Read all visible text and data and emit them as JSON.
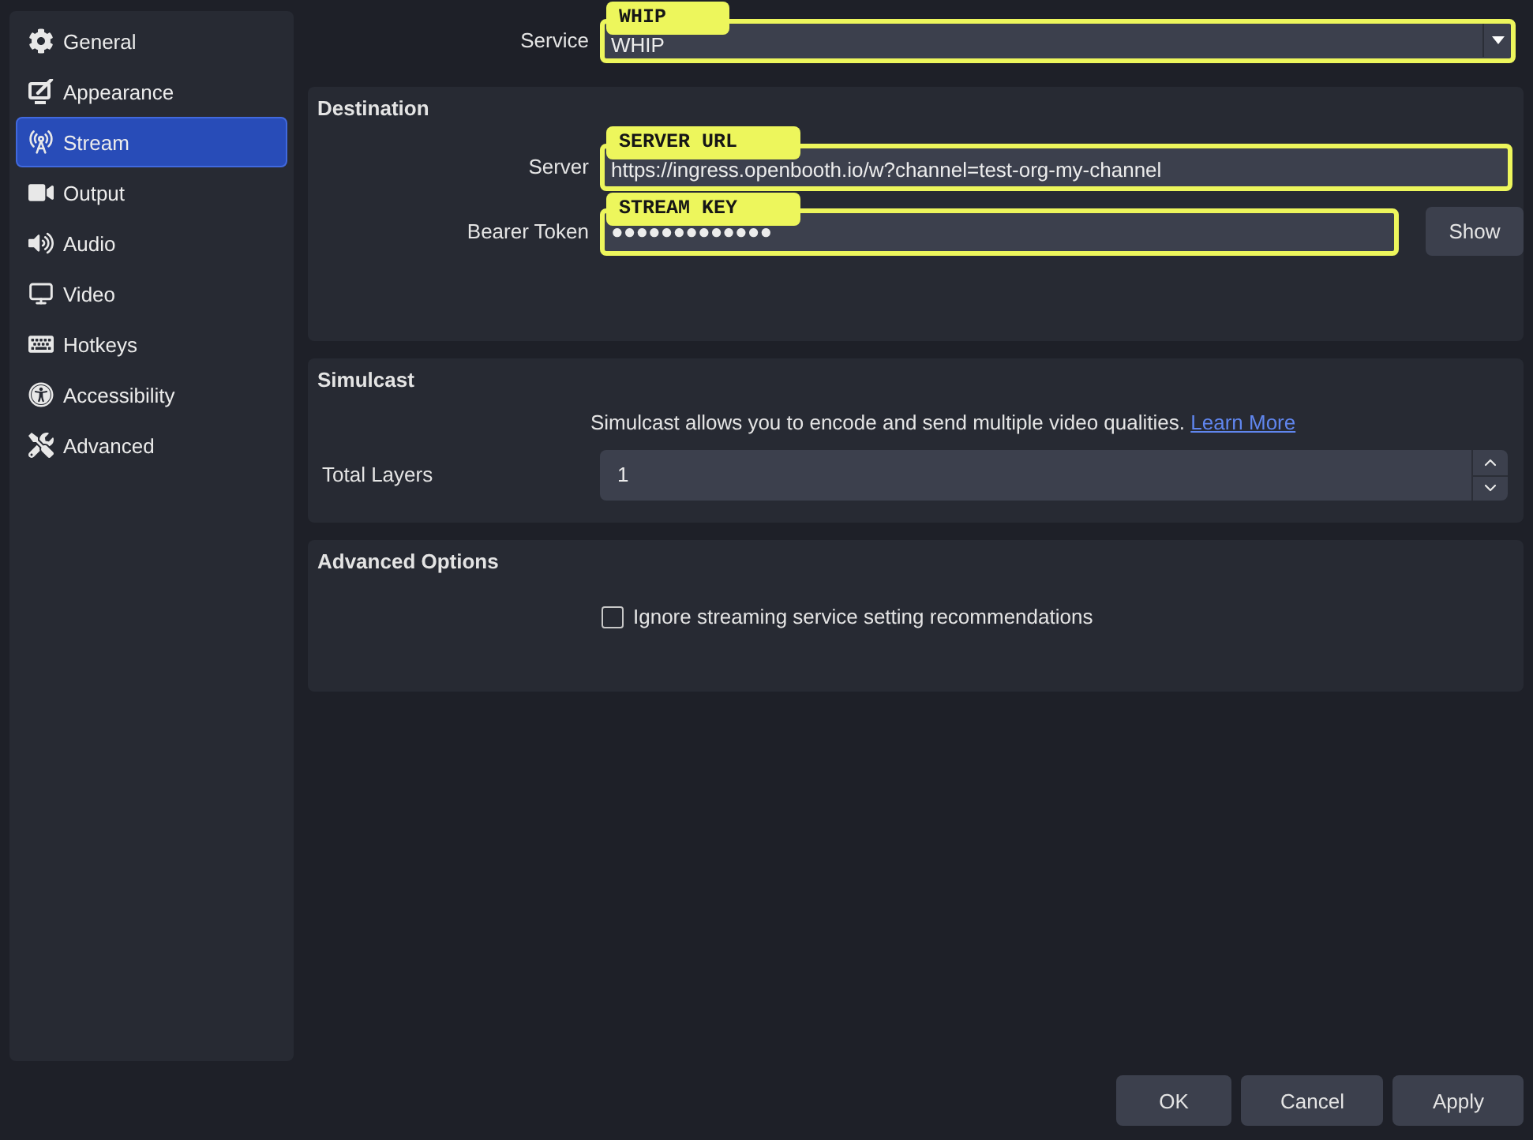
{
  "sidebar": {
    "items": [
      {
        "label": "General",
        "selected": false
      },
      {
        "label": "Appearance",
        "selected": false
      },
      {
        "label": "Stream",
        "selected": true
      },
      {
        "label": "Output",
        "selected": false
      },
      {
        "label": "Audio",
        "selected": false
      },
      {
        "label": "Video",
        "selected": false
      },
      {
        "label": "Hotkeys",
        "selected": false
      },
      {
        "label": "Accessibility",
        "selected": false
      },
      {
        "label": "Advanced",
        "selected": false
      }
    ]
  },
  "service": {
    "label": "Service",
    "value": "WHIP",
    "callout": "WHIP",
    "highlighted": true
  },
  "destination": {
    "title": "Destination",
    "fields": [
      {
        "label": "Server",
        "value": "https://ingress.openbooth.io/w?channel=test-org-my-channel",
        "callout": "SERVER URL",
        "highlighted": true
      },
      {
        "label": "Bearer Token",
        "value": "●●●●●●●●●●●●●",
        "callout": "STREAM KEY",
        "highlighted": true,
        "button": "Show"
      }
    ]
  },
  "simulcast": {
    "title": "Simulcast",
    "description": "Simulcast allows you to encode and send multiple video qualities.",
    "link": "Learn More",
    "total_layers": {
      "label": "Total Layers",
      "value": "1"
    }
  },
  "advanced_options": {
    "title": "Advanced Options",
    "checkbox": {
      "label": "Ignore streaming service setting recommendations",
      "checked": false
    }
  },
  "buttons": [
    "OK",
    "Cancel",
    "Apply"
  ]
}
